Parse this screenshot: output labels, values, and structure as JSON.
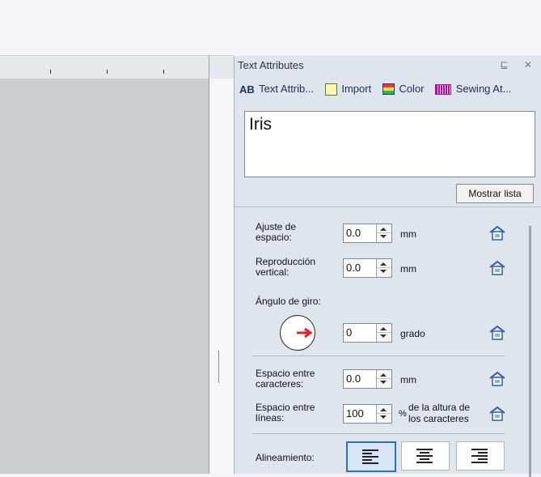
{
  "panel": {
    "title": "Text Attributes",
    "controls": "⊑ ✕",
    "tabs": [
      {
        "icon_text": "AB",
        "label": "Text Attrib..."
      },
      {
        "label": "Import"
      },
      {
        "label": "Color"
      },
      {
        "label": "Sewing At..."
      }
    ],
    "text_value": "Iris",
    "mostrar_label": "Mostrar lista"
  },
  "fields": {
    "ajuste": {
      "label_line1": "Ajuste de",
      "label_line2": "espacio:",
      "value": "0.0",
      "unit": "mm"
    },
    "reproduccion": {
      "label_line1": "Reproducción",
      "label_line2": "vertical:",
      "value": "0.0",
      "unit": "mm"
    },
    "angulo": {
      "label": "Ángulo de giro:",
      "value": "0",
      "unit": "grado"
    },
    "espacio_car": {
      "label_line1": "Espacio entre",
      "label_line2": "caracteres:",
      "value": "0.0",
      "unit": "mm"
    },
    "espacio_lin": {
      "label_line1": "Espacio entre",
      "label_line2": "líneas:",
      "value": "100",
      "unit_pct": "%",
      "unit_line1": "de la altura de",
      "unit_line2": "los caracteres"
    },
    "alineamiento": {
      "label": "Alineamiento:"
    }
  },
  "icons": {
    "reset": "home-reset-icon",
    "colors": {
      "accent": "#2e6fc0",
      "arrow": "#e0202a",
      "panel_bg": "#dfe5ec",
      "canvas_bg": "#c9cfd0"
    }
  }
}
